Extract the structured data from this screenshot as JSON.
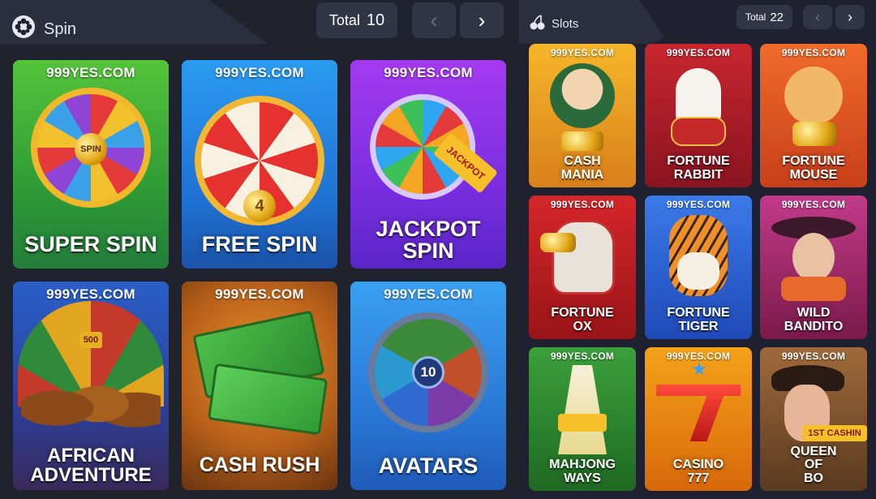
{
  "spin_section": {
    "title": "Spin",
    "icon": "film-reel-icon",
    "total_label": "Total",
    "total_count": "10",
    "prev_arrow": "‹",
    "next_arrow": "›",
    "games": [
      {
        "brand": "999YES.COM",
        "title": "SUPER SPIN",
        "wheel_text": "SPIN",
        "bg": "#3fae3a"
      },
      {
        "brand": "999YES.COM",
        "title": "FREE SPIN",
        "wheel_text": "4",
        "bg": "#2f7fe0"
      },
      {
        "brand": "999YES.COM",
        "title": "JACKPOT SPIN",
        "wheel_text": "JACKPOT",
        "bg": "#8b2fe8"
      },
      {
        "brand": "999YES.COM",
        "title": "AFRICAN ADVENTURE",
        "wheel_text": "500",
        "bg": "#1f54b6"
      },
      {
        "brand": "999YES.COM",
        "title": "CASH RUSH",
        "wheel_text": "",
        "bg": "#b86a1c"
      },
      {
        "brand": "999YES.COM",
        "title": "AVATARS",
        "wheel_text": "10",
        "bg": "#2d8fe0"
      }
    ]
  },
  "slots_section": {
    "title": "Slots",
    "icon": "cherries-icon",
    "total_label": "Total",
    "total_count": "22",
    "prev_arrow": "‹",
    "next_arrow": "›",
    "games": [
      {
        "brand": "999YES.COM",
        "title": "CASH MANIA",
        "bg": "#e79a12"
      },
      {
        "brand": "999YES.COM",
        "title": "FORTUNE RABBIT",
        "bg": "#b71d2a"
      },
      {
        "brand": "999YES.COM",
        "title": "FORTUNE MOUSE",
        "bg": "#e2561c"
      },
      {
        "brand": "999YES.COM",
        "title": "FORTUNE OX",
        "bg": "#c01c22"
      },
      {
        "brand": "999YES.COM",
        "title": "FORTUNE TIGER",
        "bg": "#2d66d8"
      },
      {
        "brand": "999YES.COM",
        "title": "WILD BANDITO",
        "bg": "#b32f7a"
      },
      {
        "brand": "999YES.COM",
        "title": "MAHJONG WAYS",
        "bg": "#2f8a2a"
      },
      {
        "brand": "999YES.COM",
        "title": "CASINO 777",
        "bg": "#e37a10"
      },
      {
        "brand": "999YES.COM",
        "title": "QUEEN OF BO",
        "badge": "1ST CASHIN",
        "bg": "#7a4a2a"
      }
    ]
  }
}
